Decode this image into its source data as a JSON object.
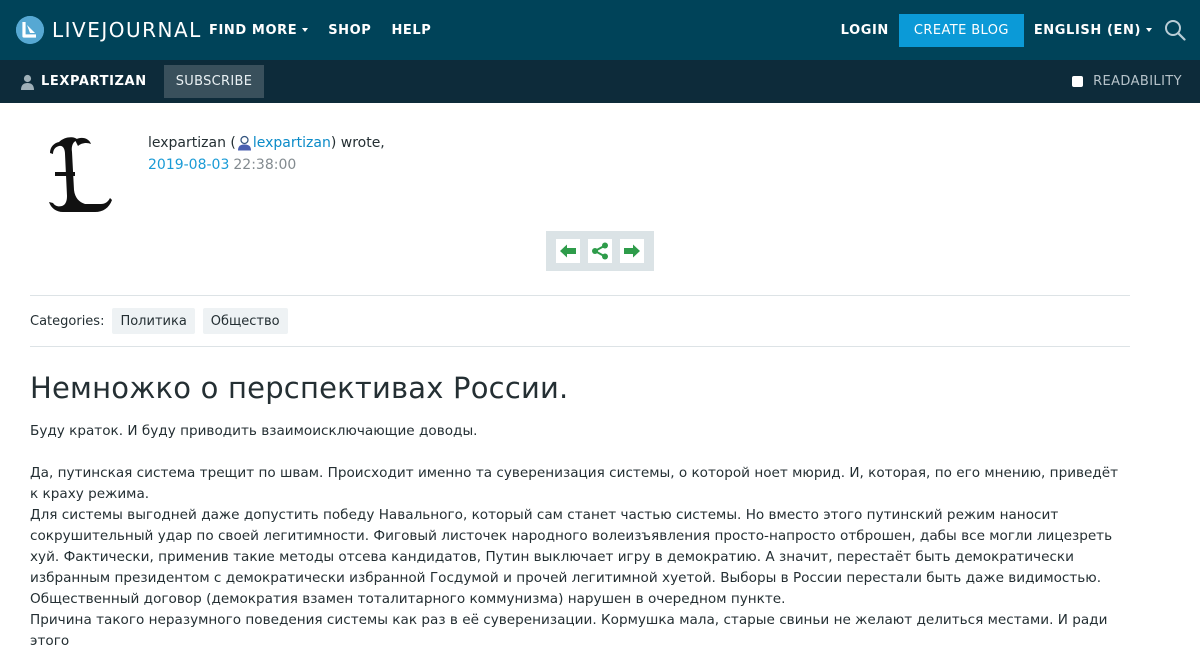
{
  "header": {
    "logo_text": "LIVEJOURNAL",
    "nav": [
      "FIND MORE",
      "SHOP",
      "HELP"
    ],
    "login": "LOGIN",
    "create_blog": "CREATE BLOG",
    "language": "ENGLISH (EN)"
  },
  "journal_bar": {
    "username": "LEXPARTIZAN",
    "subscribe": "SUBSCRIBE",
    "readability": "READABILITY"
  },
  "entry": {
    "author_display": "lexpartizan",
    "author_user": "lexpartizan",
    "wrote": ") wrote,",
    "open_paren": " (",
    "date": "2019-08-03",
    "time": "22:38:00",
    "categories_label": "Categories:",
    "categories": [
      "Политика",
      "Общество"
    ],
    "title": "Немножко о перспективах России.",
    "paragraphs": [
      "Буду краток. И буду приводить взаимоисключающие доводы.",
      "",
      "Да, путинская система трещит по швам. Происходит именно та суверенизация системы, о которой ноет мюрид. И, которая, по его мнению, приведёт к краху режима.",
      "Для системы выгодней даже допустить победу Навального, который сам станет частью системы. Но вместо этого путинский режим наносит сокрушительный удар по своей легитимности. Фиговый листочек народного волеизъявления просто-напросто отброшен, дабы все могли лицезреть хуй. Фактически, применив такие методы отсева кандидатов, Путин выключает игру в демократию. А значит, перестаёт быть демократически избранным президентом с демократически избранной Госдумой и прочей легитимной хуетой. Выборы в России перестали быть даже видимостью. Общественный договор (демократия взамен тоталитарного коммунизма) нарушен в очередном пункте.",
      "Причина такого неразумного поведения системы как раз в её суверенизации. Кормушка мала, старые свиньи не желают делиться местами. И ради этого"
    ]
  },
  "colors": {
    "topbar": "#004359",
    "journalbar": "#0d2b3a",
    "accent": "#0b9ad7",
    "nav_arrows": "#2e9c4a"
  }
}
